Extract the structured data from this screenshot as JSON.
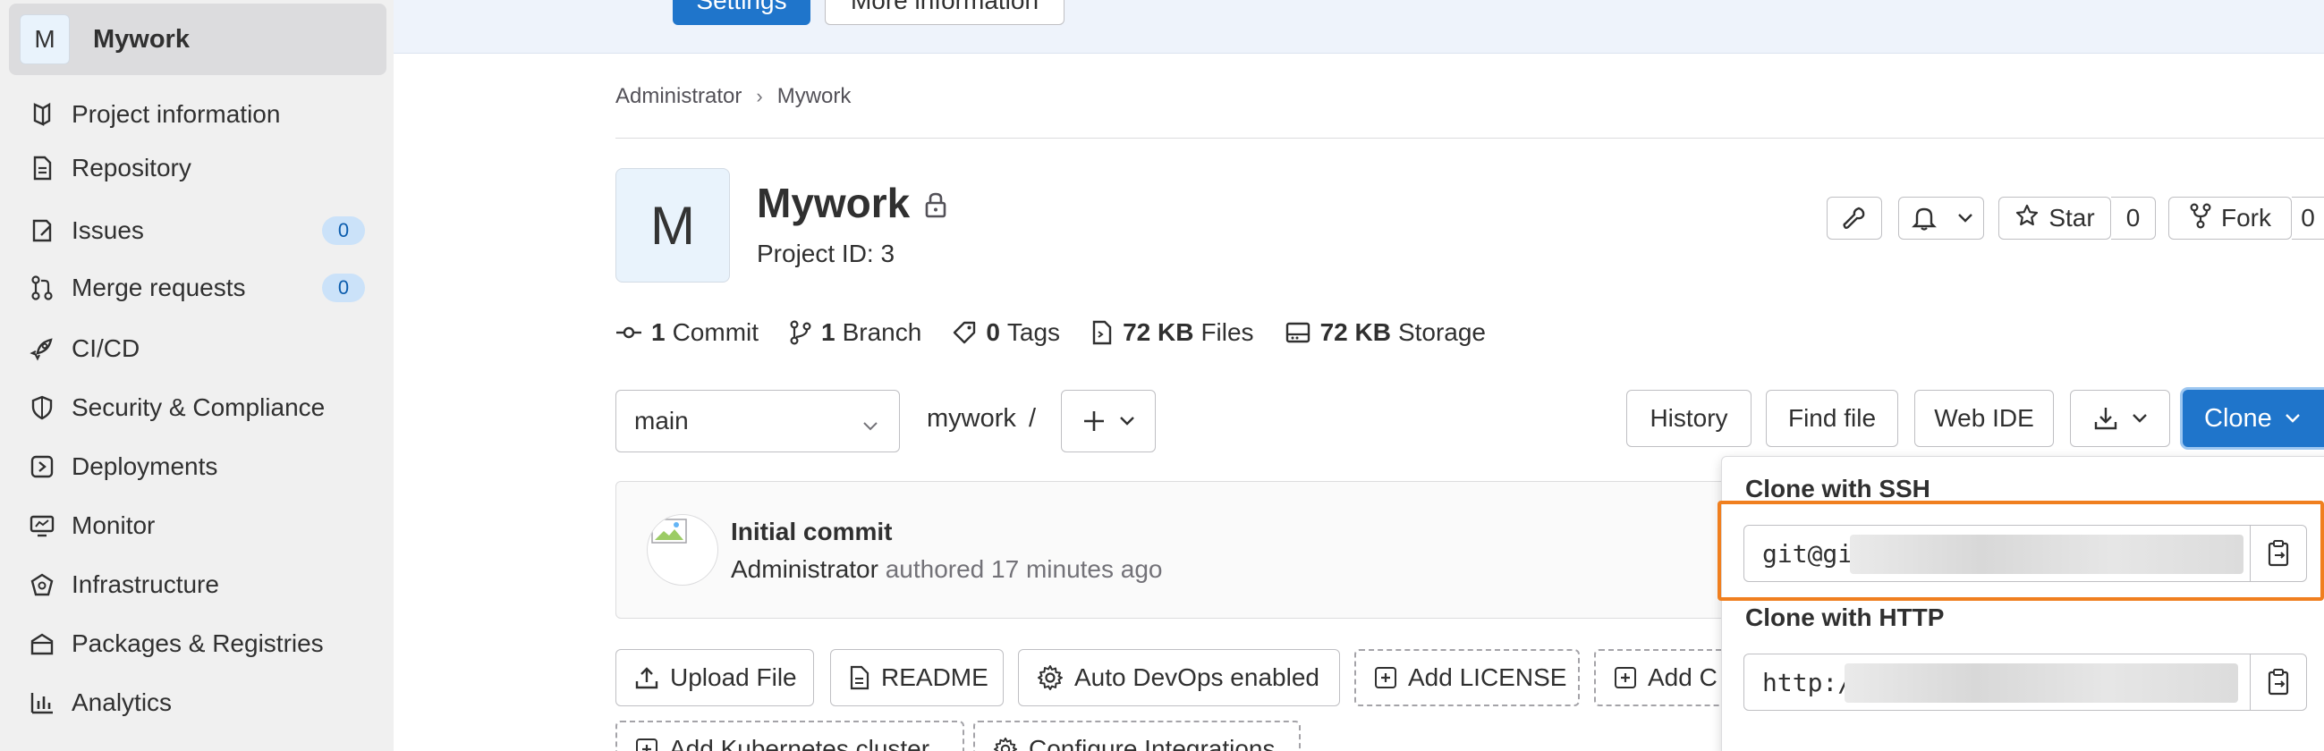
{
  "sidebar": {
    "project_initial": "M",
    "project_name": "Mywork",
    "items": [
      {
        "label": "Project information",
        "icon": "project-info-icon"
      },
      {
        "label": "Repository",
        "icon": "document-icon"
      },
      {
        "label": "Issues",
        "icon": "issues-icon",
        "badge": "0"
      },
      {
        "label": "Merge requests",
        "icon": "merge-request-icon",
        "badge": "0"
      },
      {
        "label": "CI/CD",
        "icon": "rocket-icon"
      },
      {
        "label": "Security & Compliance",
        "icon": "shield-icon"
      },
      {
        "label": "Deployments",
        "icon": "deployments-icon"
      },
      {
        "label": "Monitor",
        "icon": "monitor-icon"
      },
      {
        "label": "Infrastructure",
        "icon": "cloud-icon"
      },
      {
        "label": "Packages & Registries",
        "icon": "package-icon"
      },
      {
        "label": "Analytics",
        "icon": "analytics-icon"
      }
    ]
  },
  "banner": {
    "settings_label": "Settings",
    "more_info_label": "More information"
  },
  "breadcrumb": {
    "items": [
      "Administrator",
      "Mywork"
    ],
    "separator": "›"
  },
  "project": {
    "initial": "M",
    "name": "Mywork",
    "id_text": "Project ID: 3",
    "star_label": "Star",
    "star_count": "0",
    "fork_label": "Fork",
    "fork_count": "0"
  },
  "stats": [
    {
      "value": "1",
      "label": "Commit",
      "icon": "commit-icon"
    },
    {
      "value": "1",
      "label": "Branch",
      "icon": "branch-icon"
    },
    {
      "value": "0",
      "label": "Tags",
      "icon": "tag-icon"
    },
    {
      "value": "72 KB",
      "label": "Files",
      "icon": "file-icon"
    },
    {
      "value": "72 KB",
      "label": "Storage",
      "icon": "storage-icon"
    }
  ],
  "repo": {
    "branch": "main",
    "path": "mywork",
    "path_separator": "/",
    "history_label": "History",
    "find_file_label": "Find file",
    "web_ide_label": "Web IDE",
    "clone_label": "Clone"
  },
  "commit": {
    "title": "Initial commit",
    "author": "Administrator",
    "meta": " authored 17 minutes ago"
  },
  "actions": {
    "upload_file": "Upload File",
    "readme": "README",
    "auto_devops": "Auto DevOps enabled",
    "add_license": "Add LICENSE",
    "add_changelog": "Add C",
    "add_k8s": "Add Kubernetes cluster",
    "configure_integrations": "Configure Integrations"
  },
  "clone_dropdown": {
    "ssh_heading": "Clone with SSH",
    "ssh_value": "git@gi",
    "http_heading": "Clone with HTTP",
    "http_value": "http:/"
  },
  "colors": {
    "primary": "#1f75cb",
    "highlight": "#f07f1f",
    "badge_bg": "#cbe2f9"
  }
}
